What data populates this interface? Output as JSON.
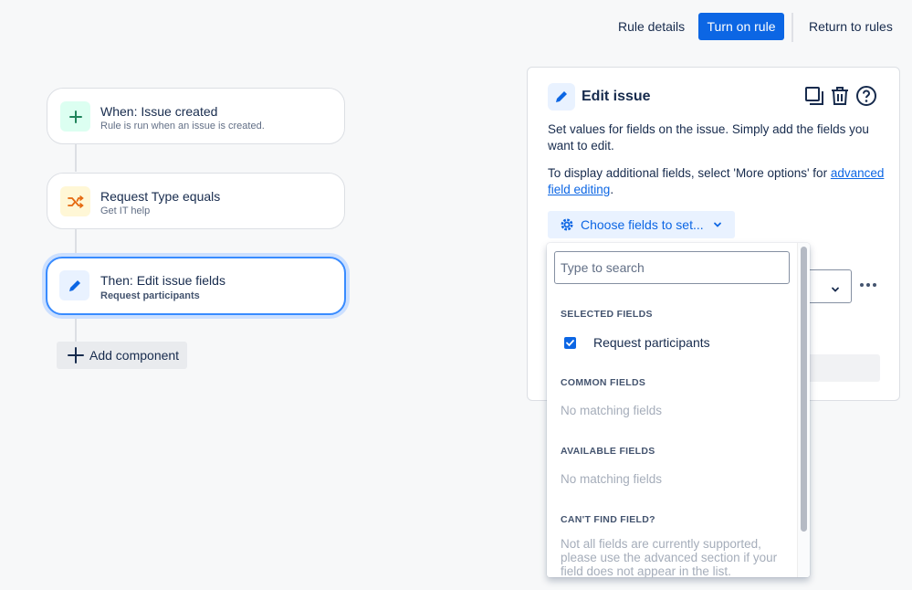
{
  "header": {
    "rule_details": "Rule details",
    "turn_on": "Turn on rule",
    "return": "Return to rules"
  },
  "flow": {
    "nodes": [
      {
        "title": "When: Issue created",
        "subtitle": "Rule is run when an issue is created.",
        "icon": "plus-icon"
      },
      {
        "title": "Request Type equals",
        "subtitle": "Get IT help",
        "icon": "shuffle-icon"
      },
      {
        "title": "Then: Edit issue fields",
        "subtitle": "Request participants",
        "icon": "pencil-icon"
      }
    ],
    "add_component": "Add component"
  },
  "panel": {
    "title": "Edit issue",
    "desc": "Set values for fields on the issue. Simply add the fields you want to edit.",
    "desc2_prefix": "To display additional fields, select 'More options' for ",
    "desc2_link": "advanced field editing",
    "desc2_suffix": ".",
    "choose_btn": "Choose fields to set..."
  },
  "dropdown": {
    "search_placeholder": "Type to search",
    "sections": {
      "selected": "SELECTED FIELDS",
      "common": "COMMON FIELDS",
      "available": "AVAILABLE FIELDS",
      "cant_find": "CAN'T FIND FIELD?"
    },
    "selected_item": "Request participants",
    "no_match": "No matching fields",
    "cant_find_text": "Not all fields are currently supported, please use the advanced section if your field does not appear in the list."
  },
  "colors": {
    "primary": "#0c66e4",
    "trigger_bg": "#dcfff1",
    "condition_bg": "#fff7d6",
    "action_bg": "#e9f2ff"
  }
}
